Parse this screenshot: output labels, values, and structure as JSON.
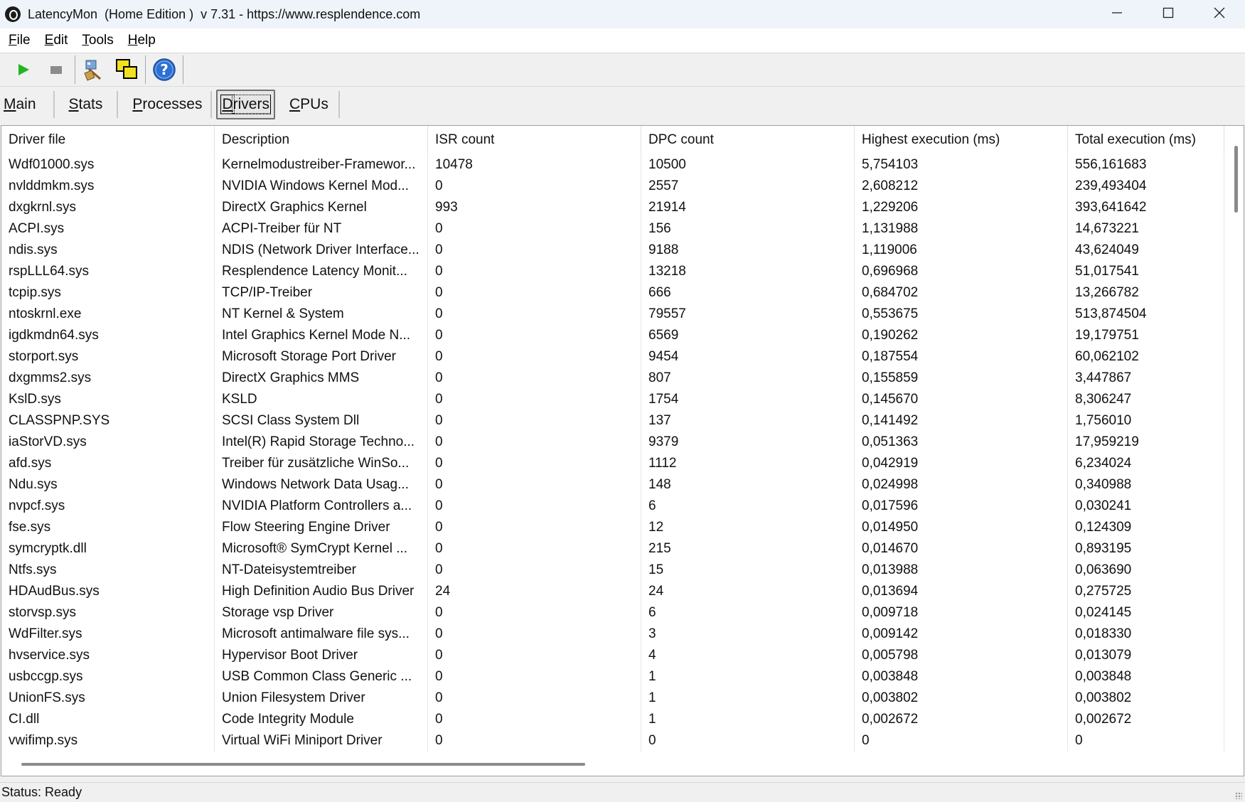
{
  "window": {
    "title": "LatencyMon  (Home Edition )  v 7.31 - https://www.resplendence.com"
  },
  "menu": [
    {
      "label": "File",
      "ul": "F",
      "rest": "ile"
    },
    {
      "label": "Edit",
      "ul": "E",
      "rest": "dit"
    },
    {
      "label": "Tools",
      "ul": "T",
      "rest": "ools"
    },
    {
      "label": "Help",
      "ul": "H",
      "rest": "elp"
    }
  ],
  "toolbar_icons": [
    "play-icon",
    "stop-icon",
    "broom-icon",
    "windows-icon",
    "help-icon"
  ],
  "tabs": [
    {
      "label": "Main",
      "ul": "M",
      "rest": "ain",
      "active": false
    },
    {
      "label": "Stats",
      "ul": "S",
      "rest": "tats",
      "active": false
    },
    {
      "label": "Processes",
      "ul": "P",
      "rest": "rocesses",
      "active": false
    },
    {
      "label": "Drivers",
      "ul": "D",
      "rest": "rivers",
      "active": true
    },
    {
      "label": "CPUs",
      "ul": "C",
      "rest": "PUs",
      "active": false
    }
  ],
  "table": {
    "columns": [
      "Driver file",
      "Description",
      "ISR count",
      "DPC count",
      "Highest execution (ms)",
      "Total execution (ms)"
    ],
    "rows": [
      [
        "Wdf01000.sys",
        "Kernelmodustreiber-Framewor...",
        "10478",
        "10500",
        "5,754103",
        "556,161683"
      ],
      [
        "nvlddmkm.sys",
        "NVIDIA Windows Kernel Mod...",
        "0",
        "2557",
        "2,608212",
        "239,493404"
      ],
      [
        "dxgkrnl.sys",
        "DirectX Graphics Kernel",
        "993",
        "21914",
        "1,229206",
        "393,641642"
      ],
      [
        "ACPI.sys",
        "ACPI-Treiber für NT",
        "0",
        "156",
        "1,131988",
        "14,673221"
      ],
      [
        "ndis.sys",
        "NDIS (Network Driver Interface...",
        "0",
        "9188",
        "1,119006",
        "43,624049"
      ],
      [
        "rspLLL64.sys",
        "Resplendence Latency Monit...",
        "0",
        "13218",
        "0,696968",
        "51,017541"
      ],
      [
        "tcpip.sys",
        "TCP/IP-Treiber",
        "0",
        "666",
        "0,684702",
        "13,266782"
      ],
      [
        "ntoskrnl.exe",
        "NT Kernel & System",
        "0",
        "79557",
        "0,553675",
        "513,874504"
      ],
      [
        "igdkmdn64.sys",
        "Intel Graphics Kernel Mode N...",
        "0",
        "6569",
        "0,190262",
        "19,179751"
      ],
      [
        "storport.sys",
        "Microsoft Storage Port Driver",
        "0",
        "9454",
        "0,187554",
        "60,062102"
      ],
      [
        "dxgmms2.sys",
        "DirectX Graphics MMS",
        "0",
        "807",
        "0,155859",
        "3,447867"
      ],
      [
        "KslD.sys",
        "KSLD",
        "0",
        "1754",
        "0,145670",
        "8,306247"
      ],
      [
        "CLASSPNP.SYS",
        "SCSI Class System Dll",
        "0",
        "137",
        "0,141492",
        "1,756010"
      ],
      [
        "iaStorVD.sys",
        "Intel(R) Rapid Storage Techno...",
        "0",
        "9379",
        "0,051363",
        "17,959219"
      ],
      [
        "afd.sys",
        "Treiber für zusätzliche WinSo...",
        "0",
        "1112",
        "0,042919",
        "6,234024"
      ],
      [
        "Ndu.sys",
        "Windows Network Data Usag...",
        "0",
        "148",
        "0,024998",
        "0,340988"
      ],
      [
        "nvpcf.sys",
        "NVIDIA Platform Controllers a...",
        "0",
        "6",
        "0,017596",
        "0,030241"
      ],
      [
        "fse.sys",
        "Flow Steering Engine Driver",
        "0",
        "12",
        "0,014950",
        "0,124309"
      ],
      [
        "symcryptk.dll",
        "Microsoft® SymCrypt Kernel ...",
        "0",
        "215",
        "0,014670",
        "0,893195"
      ],
      [
        "Ntfs.sys",
        "NT-Dateisystemtreiber",
        "0",
        "15",
        "0,013988",
        "0,063690"
      ],
      [
        "HDAudBus.sys",
        "High Definition Audio Bus Driver",
        "24",
        "24",
        "0,013694",
        "0,275725"
      ],
      [
        "storvsp.sys",
        "Storage vsp Driver",
        "0",
        "6",
        "0,009718",
        "0,024145"
      ],
      [
        "WdFilter.sys",
        "Microsoft antimalware file sys...",
        "0",
        "3",
        "0,009142",
        "0,018330"
      ],
      [
        "hvservice.sys",
        "Hypervisor Boot Driver",
        "0",
        "4",
        "0,005798",
        "0,013079"
      ],
      [
        "usbccgp.sys",
        "USB Common Class Generic ...",
        "0",
        "1",
        "0,003848",
        "0,003848"
      ],
      [
        "UnionFS.sys",
        "Union Filesystem Driver",
        "0",
        "1",
        "0,003802",
        "0,003802"
      ],
      [
        "CI.dll",
        "Code Integrity Module",
        "0",
        "1",
        "0,002672",
        "0,002672"
      ],
      [
        "vwifimp.sys",
        "Virtual WiFi Miniport Driver",
        "0",
        "0",
        "0",
        "0"
      ]
    ]
  },
  "status": "Status: Ready"
}
